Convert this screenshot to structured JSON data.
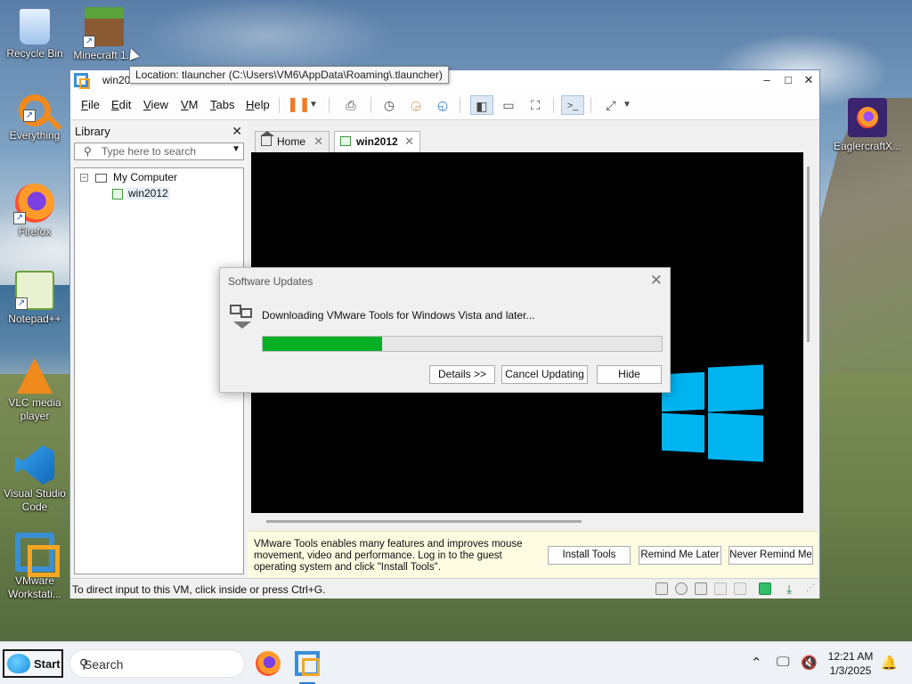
{
  "desktop": {
    "icons": [
      {
        "label": "Recycle Bin"
      },
      {
        "label": "Everything"
      },
      {
        "label": "Firefox"
      },
      {
        "label": "Notepad++"
      },
      {
        "label": "VLC media player"
      },
      {
        "label": "Visual Studio Code"
      },
      {
        "label": "VMware Workstati..."
      },
      {
        "label": "Minecraft 1..."
      },
      {
        "label": "EaglercraftX..."
      }
    ],
    "tooltip": "Location: tlauncher (C:\\Users\\VM6\\AppData\\Roaming\\.tlauncher)"
  },
  "window": {
    "title": "win20",
    "controls": {
      "minimize": "–",
      "maximize": "□",
      "close": "✕"
    }
  },
  "menu": {
    "items": [
      {
        "u": "F",
        "rest": "ile"
      },
      {
        "u": "E",
        "rest": "dit"
      },
      {
        "u": "V",
        "rest": "iew"
      },
      {
        "u": "V",
        "rest": "M"
      },
      {
        "u": "T",
        "rest": "abs"
      },
      {
        "u": "H",
        "rest": "elp"
      }
    ]
  },
  "toolbar": {
    "pause_icon": "pause-icon",
    "accent": "#f07a22"
  },
  "library": {
    "title": "Library",
    "search_placeholder": "Type here to search",
    "tree": {
      "root": "My Computer",
      "child": "win2012"
    }
  },
  "tabs": [
    {
      "label": "Home"
    },
    {
      "label": "win2012"
    }
  ],
  "notice": {
    "text": "VMware Tools enables many features and improves mouse movement, video and performance. Log in to the guest operating system and click \"Install Tools\".",
    "install": "Install Tools",
    "remind": "Remind Me Later",
    "never": "Never Remind Me"
  },
  "status": {
    "text": "To direct input to this VM, click inside or press Ctrl+G."
  },
  "dialog": {
    "title": "Software Updates",
    "message": "Downloading VMware Tools for Windows Vista and later...",
    "progress_fraction": 0.3,
    "progress_color": "#06b025",
    "details": "Details >>",
    "cancel": "Cancel Updating",
    "hide": "Hide"
  },
  "taskbar": {
    "start": "Start",
    "search_placeholder": "Search",
    "time": "12:21 AM",
    "date": "1/3/2025"
  }
}
